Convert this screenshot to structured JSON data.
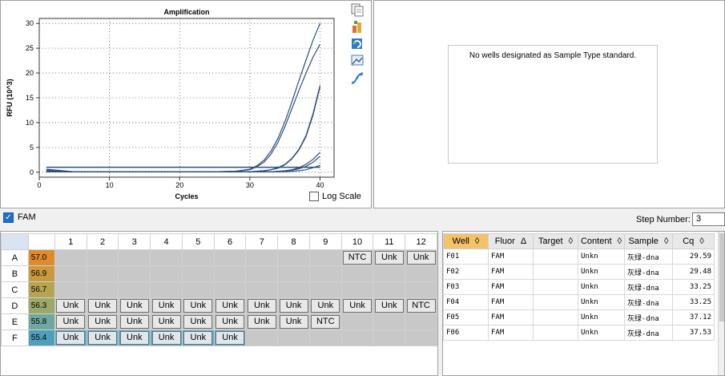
{
  "chart": {
    "title": "Amplification",
    "ylabel": "RFU (10^3)",
    "xlabel": "Cycles",
    "log_scale_label": "Log Scale"
  },
  "chart_data": {
    "type": "line",
    "title": "Amplification",
    "xlabel": "Cycles",
    "ylabel": "RFU (10^3)",
    "xlim": [
      0,
      42
    ],
    "ylim": [
      -1,
      31
    ],
    "x_ticks": [
      "0",
      "10",
      "20",
      "30",
      "40"
    ],
    "y_ticks": [
      "0",
      "5",
      "10",
      "15",
      "20",
      "25",
      "30"
    ],
    "grid": true,
    "line_color": "#2d4f7c",
    "threshold": 1.0,
    "x": [
      1,
      5,
      10,
      15,
      20,
      25,
      28,
      30,
      31,
      32,
      33,
      34,
      35,
      36,
      37,
      38,
      39,
      40
    ],
    "series": [
      {
        "values": [
          0.6,
          0.1,
          0.1,
          0.1,
          0.1,
          0.1,
          0.2,
          0.6,
          1.3,
          2.4,
          4.2,
          6.8,
          10.2,
          14.2,
          18.5,
          22.6,
          26.6,
          30.0
        ]
      },
      {
        "values": [
          0.4,
          0.1,
          0.1,
          0.1,
          0.1,
          0.1,
          0.2,
          0.5,
          1.1,
          2.0,
          3.6,
          6.0,
          9.2,
          12.8,
          16.5,
          20.0,
          23.2,
          25.8
        ]
      },
      {
        "values": [
          0.2,
          0.1,
          0.1,
          0.1,
          0.1,
          0.1,
          0.1,
          0.1,
          0.2,
          0.3,
          0.5,
          0.9,
          1.6,
          2.8,
          4.6,
          7.4,
          11.8,
          17.5
        ]
      },
      {
        "values": [
          0.2,
          0.1,
          0.1,
          0.1,
          0.1,
          0.1,
          0.1,
          0.1,
          0.2,
          0.3,
          0.5,
          0.8,
          1.5,
          2.7,
          4.5,
          7.2,
          11.5,
          17.2
        ]
      },
      {
        "values": [
          0.1,
          0.1,
          0.1,
          0.1,
          0.1,
          0.1,
          0.1,
          0.1,
          0.1,
          0.1,
          0.1,
          0.2,
          0.3,
          0.5,
          0.9,
          1.6,
          2.6,
          4.0
        ]
      },
      {
        "values": [
          0.1,
          0.1,
          0.1,
          0.1,
          0.1,
          0.1,
          0.1,
          0.1,
          0.1,
          0.1,
          0.1,
          0.1,
          0.2,
          0.4,
          0.7,
          1.2,
          2.0,
          3.2
        ]
      },
      {
        "values": [
          0.1,
          0.1,
          0.1,
          0.1,
          0.1,
          0.1,
          0.1,
          0.1,
          0.1,
          0.1,
          0.1,
          0.1,
          0.1,
          0.2,
          0.3,
          0.5,
          0.9,
          1.4
        ]
      }
    ]
  },
  "standard_curve": {
    "message": "No wells designated as Sample Type standard."
  },
  "toolbar_icons": [
    "copy-icon",
    "chart-export-icon",
    "refresh-icon",
    "image-icon",
    "curve-fit-icon"
  ],
  "fluor_bar": {
    "fluor_label": "FAM",
    "fluor_checked": true,
    "step_label": "Step Number:",
    "step_value": "3"
  },
  "plate": {
    "columns": [
      "1",
      "2",
      "3",
      "4",
      "5",
      "6",
      "7",
      "8",
      "9",
      "10",
      "11",
      "12"
    ],
    "rows": [
      {
        "label": "A",
        "temp": "57.0",
        "temp_color": "#e08a2a",
        "cells": [
          "",
          "",
          "",
          "",
          "",
          "",
          "",
          "",
          "",
          "NTC",
          "Unk",
          "Unk"
        ],
        "selected": []
      },
      {
        "label": "B",
        "temp": "56.9",
        "temp_color": "#c9993d",
        "cells": [
          "",
          "",
          "",
          "",
          "",
          "",
          "",
          "",
          "",
          "",
          "",
          ""
        ],
        "selected": []
      },
      {
        "label": "C",
        "temp": "56.7",
        "temp_color": "#b5a553",
        "cells": [
          "",
          "",
          "",
          "",
          "",
          "",
          "",
          "",
          "",
          "",
          "",
          ""
        ],
        "selected": []
      },
      {
        "label": "D",
        "temp": "56.3",
        "temp_color": "#9aa86a",
        "cells": [
          "Unk",
          "Unk",
          "Unk",
          "Unk",
          "Unk",
          "Unk",
          "Unk",
          "Unk",
          "Unk",
          "Unk",
          "Unk",
          "NTC"
        ],
        "selected": []
      },
      {
        "label": "E",
        "temp": "55.8",
        "temp_color": "#6fa8a0",
        "cells": [
          "Unk",
          "Unk",
          "Unk",
          "Unk",
          "Unk",
          "Unk",
          "Unk",
          "Unk",
          "NTC",
          "",
          "",
          ""
        ],
        "selected": []
      },
      {
        "label": "F",
        "temp": "55.4",
        "temp_color": "#4f9fbc",
        "cells": [
          "Unk",
          "Unk",
          "Unk",
          "Unk",
          "Unk",
          "Unk",
          "",
          "",
          "",
          "",
          "",
          ""
        ],
        "selected": [
          0,
          1,
          2,
          3,
          4,
          5
        ]
      }
    ]
  },
  "results": {
    "headers": [
      "Well",
      "Fluor",
      "Target",
      "Content",
      "Sample",
      "Cq"
    ],
    "sort_marks": [
      "◊",
      "Δ",
      "◊",
      "◊",
      "◊",
      "◊"
    ],
    "rows": [
      [
        "F01",
        "FAM",
        "",
        "Unkn",
        "灰绿-dna",
        "29.59"
      ],
      [
        "F02",
        "FAM",
        "",
        "Unkn",
        "灰绿-dna",
        "29.48"
      ],
      [
        "F03",
        "FAM",
        "",
        "Unkn",
        "灰绿-dna",
        "33.25"
      ],
      [
        "F04",
        "FAM",
        "",
        "Unkn",
        "灰绿-dna",
        "33.25"
      ],
      [
        "F05",
        "FAM",
        "",
        "Unkn",
        "灰绿-dna",
        "37.12"
      ],
      [
        "F06",
        "FAM",
        "",
        "Unkn",
        "灰绿-dna",
        "37.53"
      ]
    ]
  }
}
